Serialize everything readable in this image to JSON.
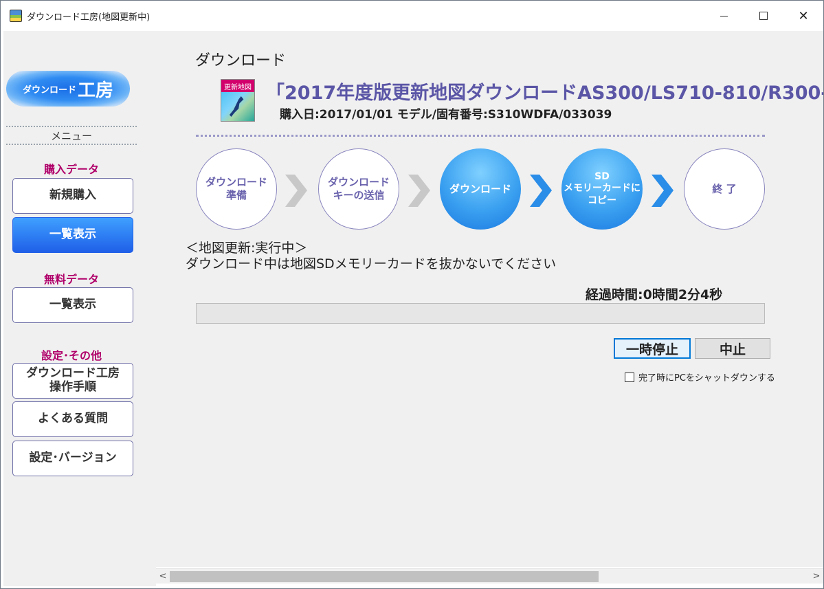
{
  "window": {
    "title": "ダウンロード工房(地図更新中)",
    "minimize_icon": "minimize-icon",
    "maximize_icon": "maximize-icon",
    "close_label": "✕"
  },
  "sidebar": {
    "logo_small": "ダウンロード",
    "logo_big": "工房",
    "menu_label": "メニュー",
    "sections": [
      {
        "label": "購入データ",
        "items": [
          {
            "label": "新規購入",
            "active": false
          },
          {
            "label": "一覧表示",
            "active": true
          }
        ]
      },
      {
        "label": "無料データ",
        "items": [
          {
            "label": "一覧表示",
            "active": false
          }
        ]
      },
      {
        "label": "設定･その他",
        "items": [
          {
            "label": "ダウンロード工房\n操作手順",
            "active": false
          },
          {
            "label": "よくある質問",
            "active": false
          },
          {
            "label": "設定･バージョン",
            "active": false
          }
        ]
      }
    ]
  },
  "main": {
    "page_title": "ダウンロード",
    "product_icon_label": "更新地図",
    "product_title": "「2017年度版更新地図ダウンロードAS300/LS710-810/R300-",
    "product_sub": "購入日:2017/01/01  モデル/固有番号:S310WDFA/033039",
    "steps": [
      {
        "label": "ダウンロード\n準備",
        "state": "pending"
      },
      {
        "label": "ダウンロード\nキーの送信",
        "state": "pending"
      },
      {
        "label": "ダウンロード",
        "state": "current"
      },
      {
        "label": "SD\nメモリーカードに\nコピー",
        "state": "current"
      },
      {
        "label": "終 了",
        "state": "pending"
      }
    ],
    "status_line1": "＜地図更新:実行中＞",
    "status_line2": "ダウンロード中は地図SDメモリーカードを抜かないでください",
    "elapsed": "経過時間:0時間2分4秒",
    "progress_percent": 0,
    "pause_label": "一時停止",
    "stop_label": "中止",
    "shutdown_checkbox_label": "完了時にPCをシャットダウンする",
    "shutdown_checked": false
  },
  "scrollbar": {
    "left_arrow": "<",
    "right_arrow": ">"
  },
  "colors": {
    "accent_blue": "#1f5fe8",
    "title_purple": "#5b56a6",
    "section_magenta": "#b0006a",
    "arrow_gray": "#c8c8c8",
    "arrow_blue": "#2a8de8"
  }
}
